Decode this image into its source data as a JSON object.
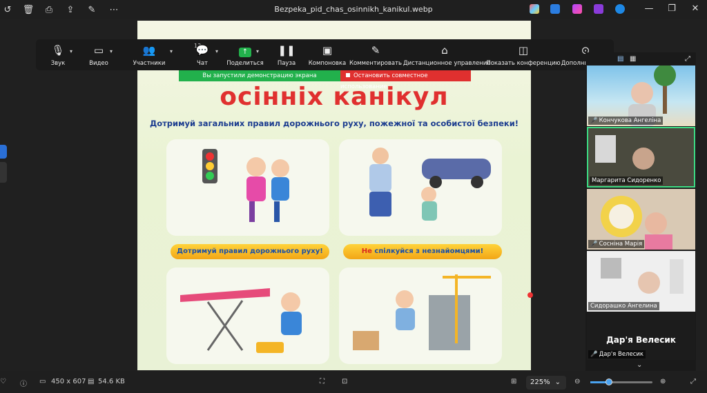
{
  "window": {
    "title": "Bezpeka_pid_chas_osinnikh_kanikul.webp"
  },
  "image_content": {
    "headline": "осінніх канікул",
    "subheadline": "Дотримуй загальних правил дорожнього руху, пожежної та особистої безпеки!",
    "banner_left": "Дотримуй правил дорожнього руху!",
    "banner_right_prefix": "Не",
    "banner_right_rest": " спілкуйся з незнайомцями!"
  },
  "zoom_toolbar": {
    "items": [
      {
        "label": "Звук",
        "icon": "microphone-icon"
      },
      {
        "label": "Видео",
        "icon": "video-camera-icon"
      },
      {
        "label": "Участники",
        "icon": "participants-icon"
      },
      {
        "label": "Чат",
        "icon": "chat-icon"
      },
      {
        "label": "Поделиться",
        "icon": "share-screen-icon"
      },
      {
        "label": "Пауза",
        "icon": "pause-icon"
      },
      {
        "label": "Компоновка",
        "icon": "layout-icon"
      },
      {
        "label": "Комментировать",
        "icon": "annotate-pen-icon"
      },
      {
        "label": "Дистанционное управление",
        "icon": "remote-control-mouse-icon"
      },
      {
        "label": "Показать конференцию",
        "icon": "show-meeting-icon"
      },
      {
        "label": "Дополнительно",
        "icon": "more-icon"
      }
    ],
    "participants_count": "13",
    "share_status": "Вы запустили демонстрацию экрана",
    "stop_share": "Остановить совместное использование"
  },
  "gallery": {
    "participants": [
      {
        "name": "Кончукова Ангеліна",
        "muted": true
      },
      {
        "name": "Маргарита Сидоренко",
        "muted": false
      },
      {
        "name": "Сосніна Марія",
        "muted": true
      },
      {
        "name": "Сидорашко Ангелина",
        "muted": false
      },
      {
        "name": "Дар'я Велесик",
        "muted": true
      }
    ],
    "big_name": "Дар'я Велесик"
  },
  "statusbar": {
    "dimensions": "450 x 607",
    "filesize": "54.6 KB",
    "zoom": "225%"
  },
  "colors": {
    "share_green": "#22b14c",
    "share_red": "#e0302f",
    "accent_blue": "#4aa3f0",
    "active_tile_border": "#3ddc84"
  }
}
